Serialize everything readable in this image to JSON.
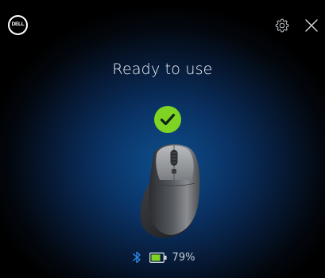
{
  "header": {
    "logo_text": "DELL",
    "settings_icon": "gear-icon",
    "close_icon": "close-icon"
  },
  "main": {
    "status_title": "Ready to use",
    "status_icon": "checkmark-icon",
    "device_image": "mouse-image"
  },
  "footer": {
    "connection_icon": "bluetooth-icon",
    "battery_icon": "battery-icon",
    "battery_level": 0.79,
    "battery_text": "79%"
  },
  "colors": {
    "accent_green": "#7fd322",
    "bluetooth_blue": "#2d8cf0",
    "background_glow": "#0d4f8c"
  }
}
